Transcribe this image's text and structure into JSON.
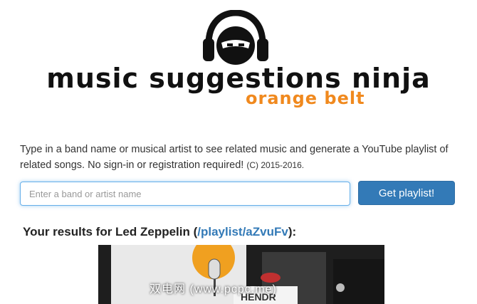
{
  "brand": {
    "title": "music suggestions ninja",
    "subtitle": "orange belt",
    "accent": "#f0891e"
  },
  "intro": {
    "text": "Type in a band name or musical artist to see related music and generate a YouTube playlist of related songs. No sign-in or registration required! ",
    "copyright": "(C) 2015-2016."
  },
  "search": {
    "placeholder": "Enter a band or artist name",
    "value": ""
  },
  "button": {
    "label": "Get playlist!",
    "color": "#337ab7"
  },
  "results": {
    "prefix": "Your results for Led Zeppelin (",
    "link": "/playlist/aZvuFv",
    "suffix": "):"
  },
  "video": {
    "overlay_text": "HENDR",
    "watermark": "双电网 (www.pcpc.me)"
  }
}
